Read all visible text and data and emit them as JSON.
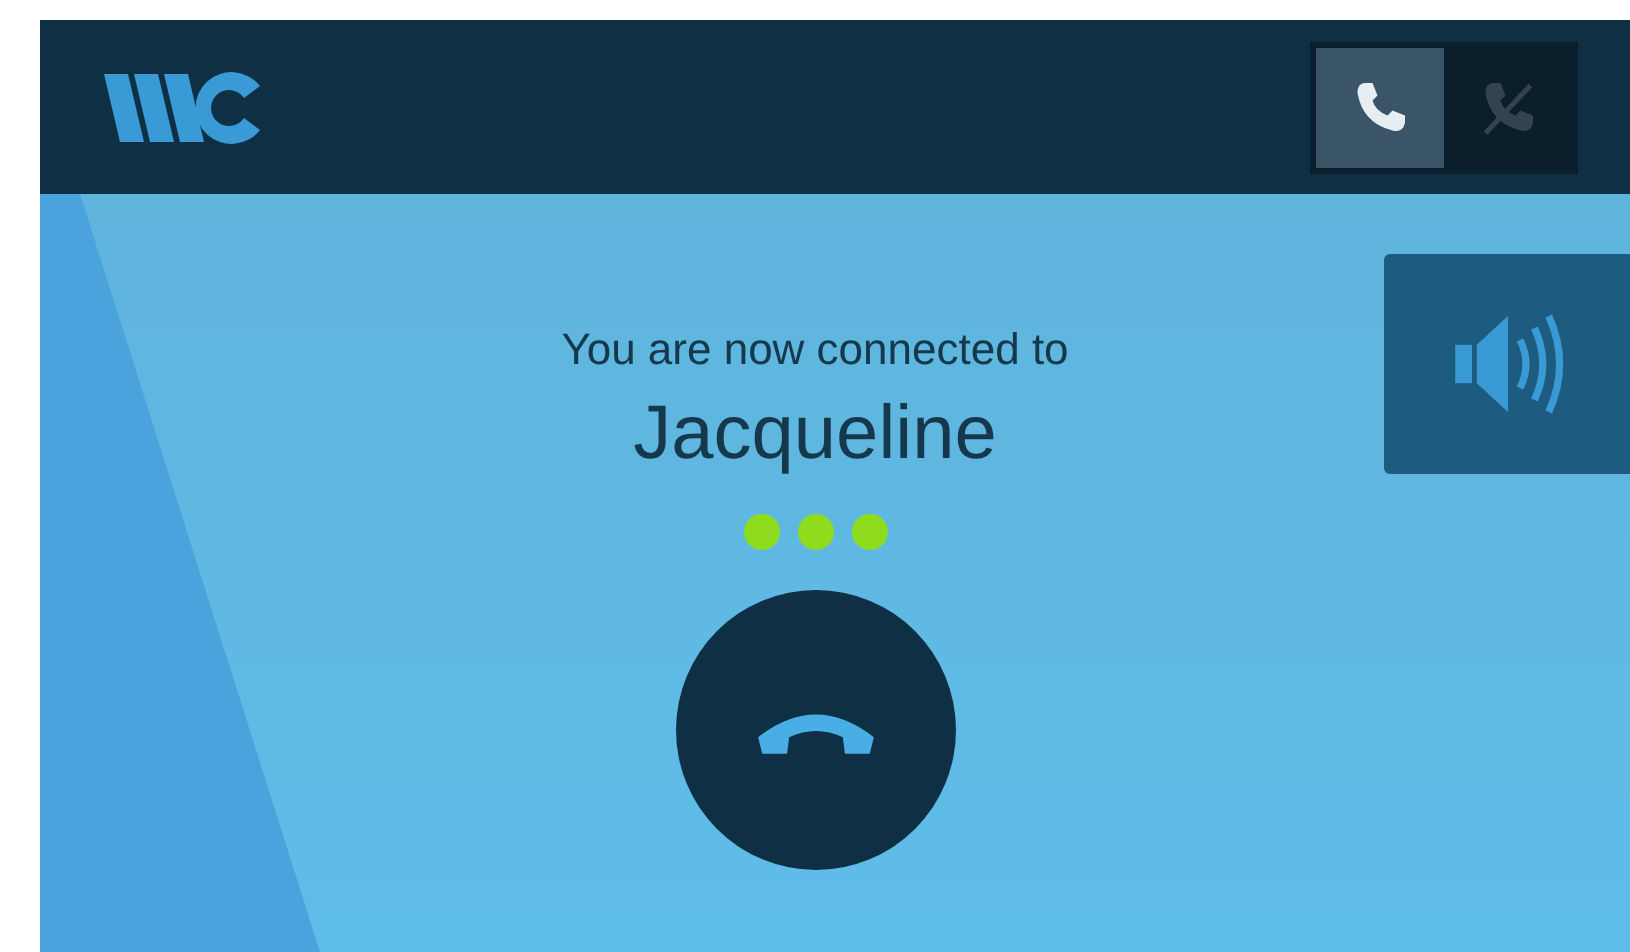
{
  "header": {
    "call_modes": [
      {
        "kind": "call",
        "selected": true
      },
      {
        "kind": "call-off",
        "selected": false
      }
    ]
  },
  "call": {
    "message": "You are now connected to",
    "contact": "Jacqueline",
    "dots": [
      {
        "on": true
      },
      {
        "on": true
      },
      {
        "on": true
      }
    ]
  }
}
